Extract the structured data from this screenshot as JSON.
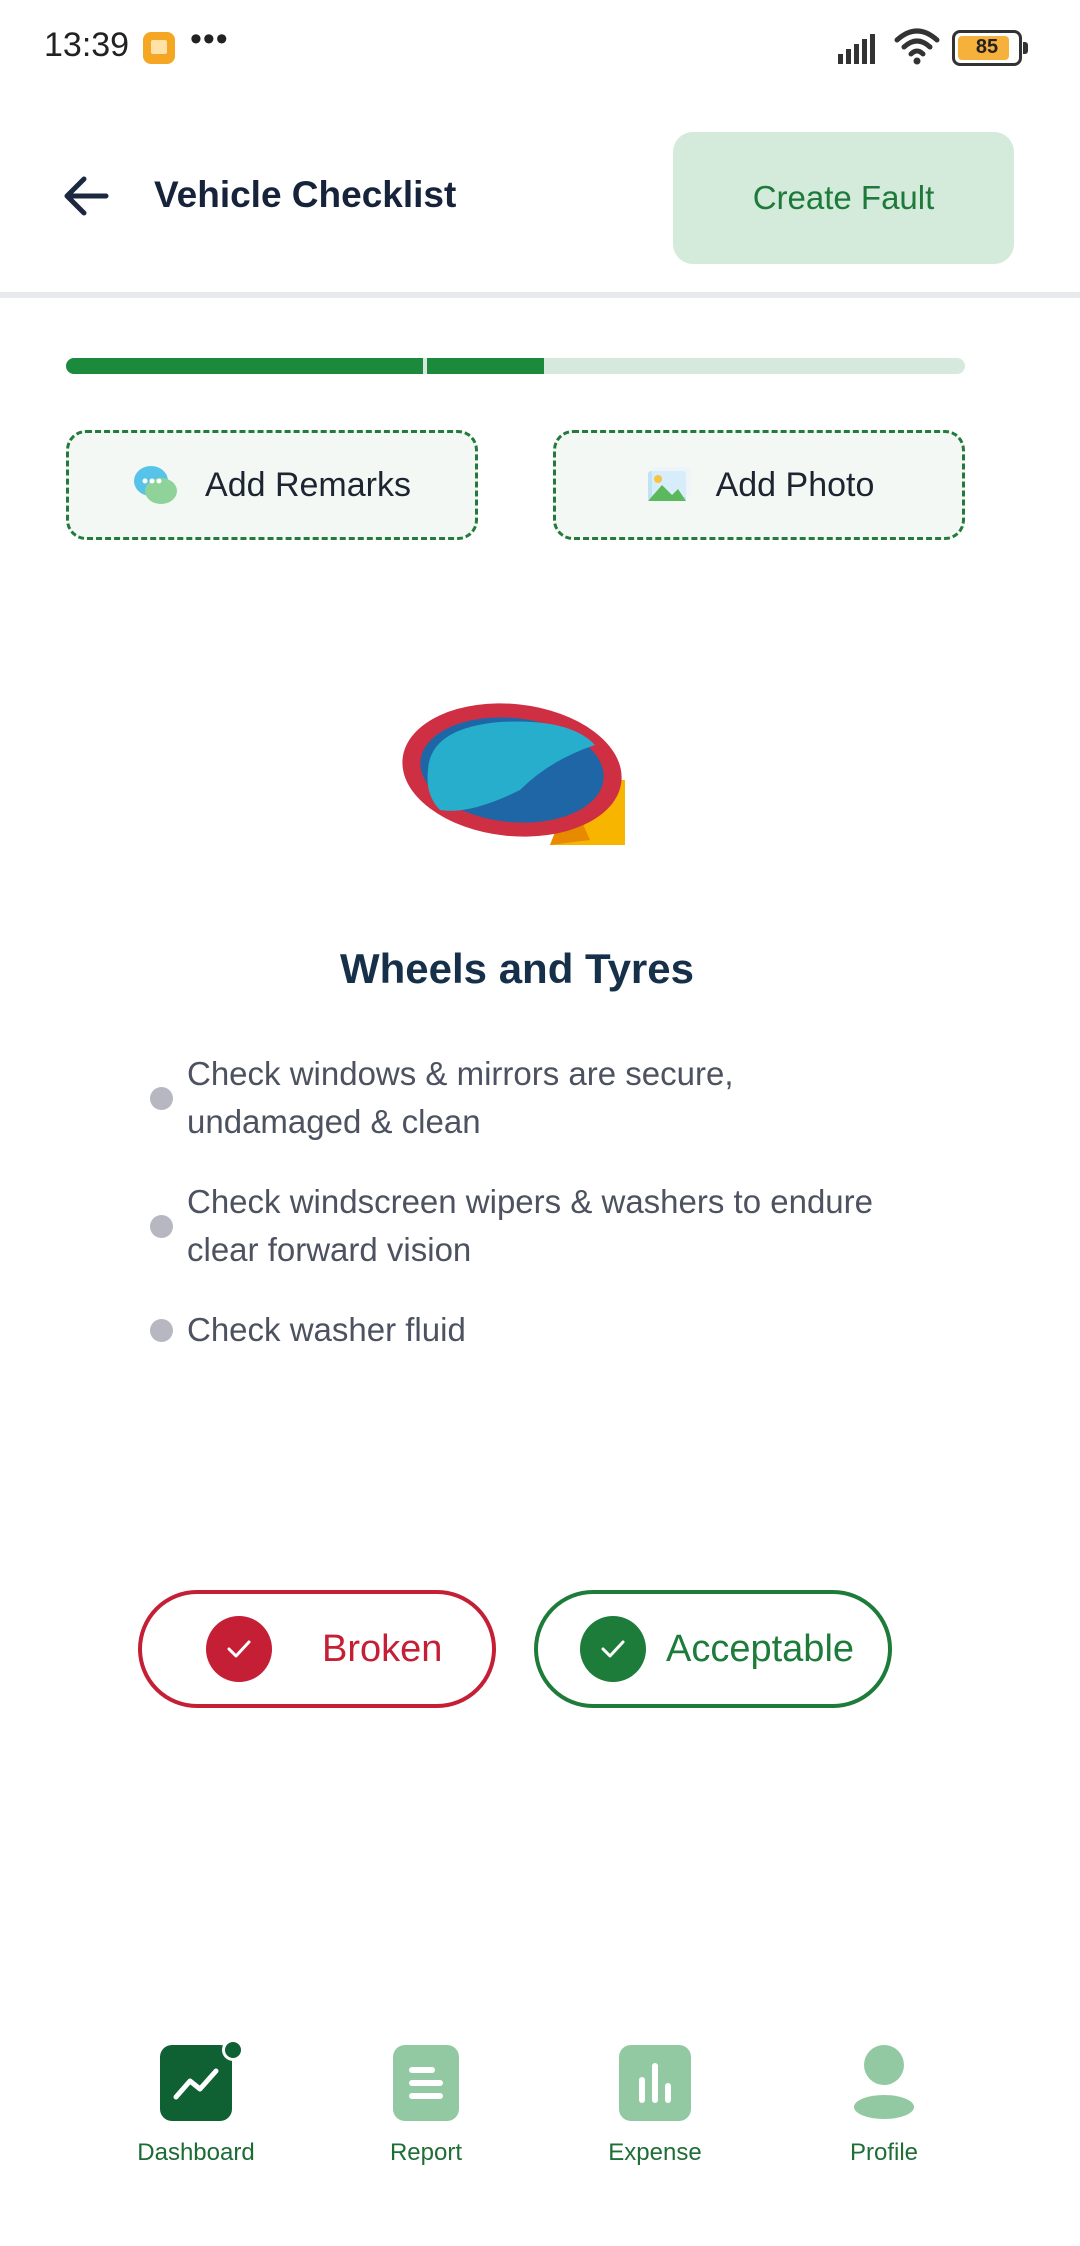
{
  "status_bar": {
    "time": "13:39",
    "dots": "•••",
    "battery": "85",
    "icons": [
      "app-notification-icon",
      "signal-icon",
      "wifi-icon",
      "battery-icon"
    ]
  },
  "header": {
    "title": "Vehicle Checklist",
    "back_icon": "arrow-left-icon",
    "create_fault_label": "Create Fault"
  },
  "progress": {
    "completed_fraction": 0.53
  },
  "actions": {
    "remarks_label": "Add Remarks",
    "remarks_icon": "chat-bubbles-icon",
    "photo_label": "Add Photo",
    "photo_icon": "image-icon"
  },
  "illustration": "side-mirror-icon",
  "section": {
    "title": "Wheels and Tyres",
    "items": [
      "Check windows & mirrors are secure, undamaged & clean",
      "Check windscreen wipers & washers to endure clear forward vision",
      "Check washer fluid"
    ]
  },
  "status_buttons": {
    "broken_label": "Broken",
    "acceptable_label": "Acceptable"
  },
  "bottom_nav": {
    "items": [
      {
        "label": "Dashboard",
        "icon": "dashboard-chart-icon",
        "active": true
      },
      {
        "label": "Report",
        "icon": "report-icon",
        "active": false
      },
      {
        "label": "Expense",
        "icon": "expense-bars-icon",
        "active": false
      },
      {
        "label": "Profile",
        "icon": "profile-icon",
        "active": false
      }
    ]
  },
  "colors": {
    "primary_green": "#1b8a3c",
    "light_green": "#d4eada",
    "danger_red": "#c41f35",
    "text_dark": "#16233b"
  }
}
